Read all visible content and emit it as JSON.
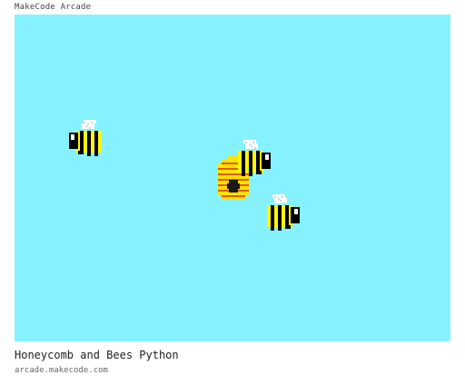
{
  "app": {
    "title": "MakeCode Arcade"
  },
  "game": {
    "name": "Honeycomb and Bees Python",
    "url": "arcade.makecode.com",
    "background_color": "#87f2ff",
    "sprites": [
      {
        "kind": "bee",
        "facing": "left"
      },
      {
        "kind": "bee",
        "facing": "right"
      },
      {
        "kind": "bee",
        "facing": "right"
      },
      {
        "kind": "beehive"
      }
    ]
  },
  "colors": {
    "bee_yellow": "#fff609",
    "bee_black": "#000000",
    "wing_white": "#ffffff",
    "wing_shade": "#c8d7e6",
    "hive_yellow": "#fce300",
    "hive_stripe": "#e05c00",
    "hive_door": "#1a1a1a"
  }
}
